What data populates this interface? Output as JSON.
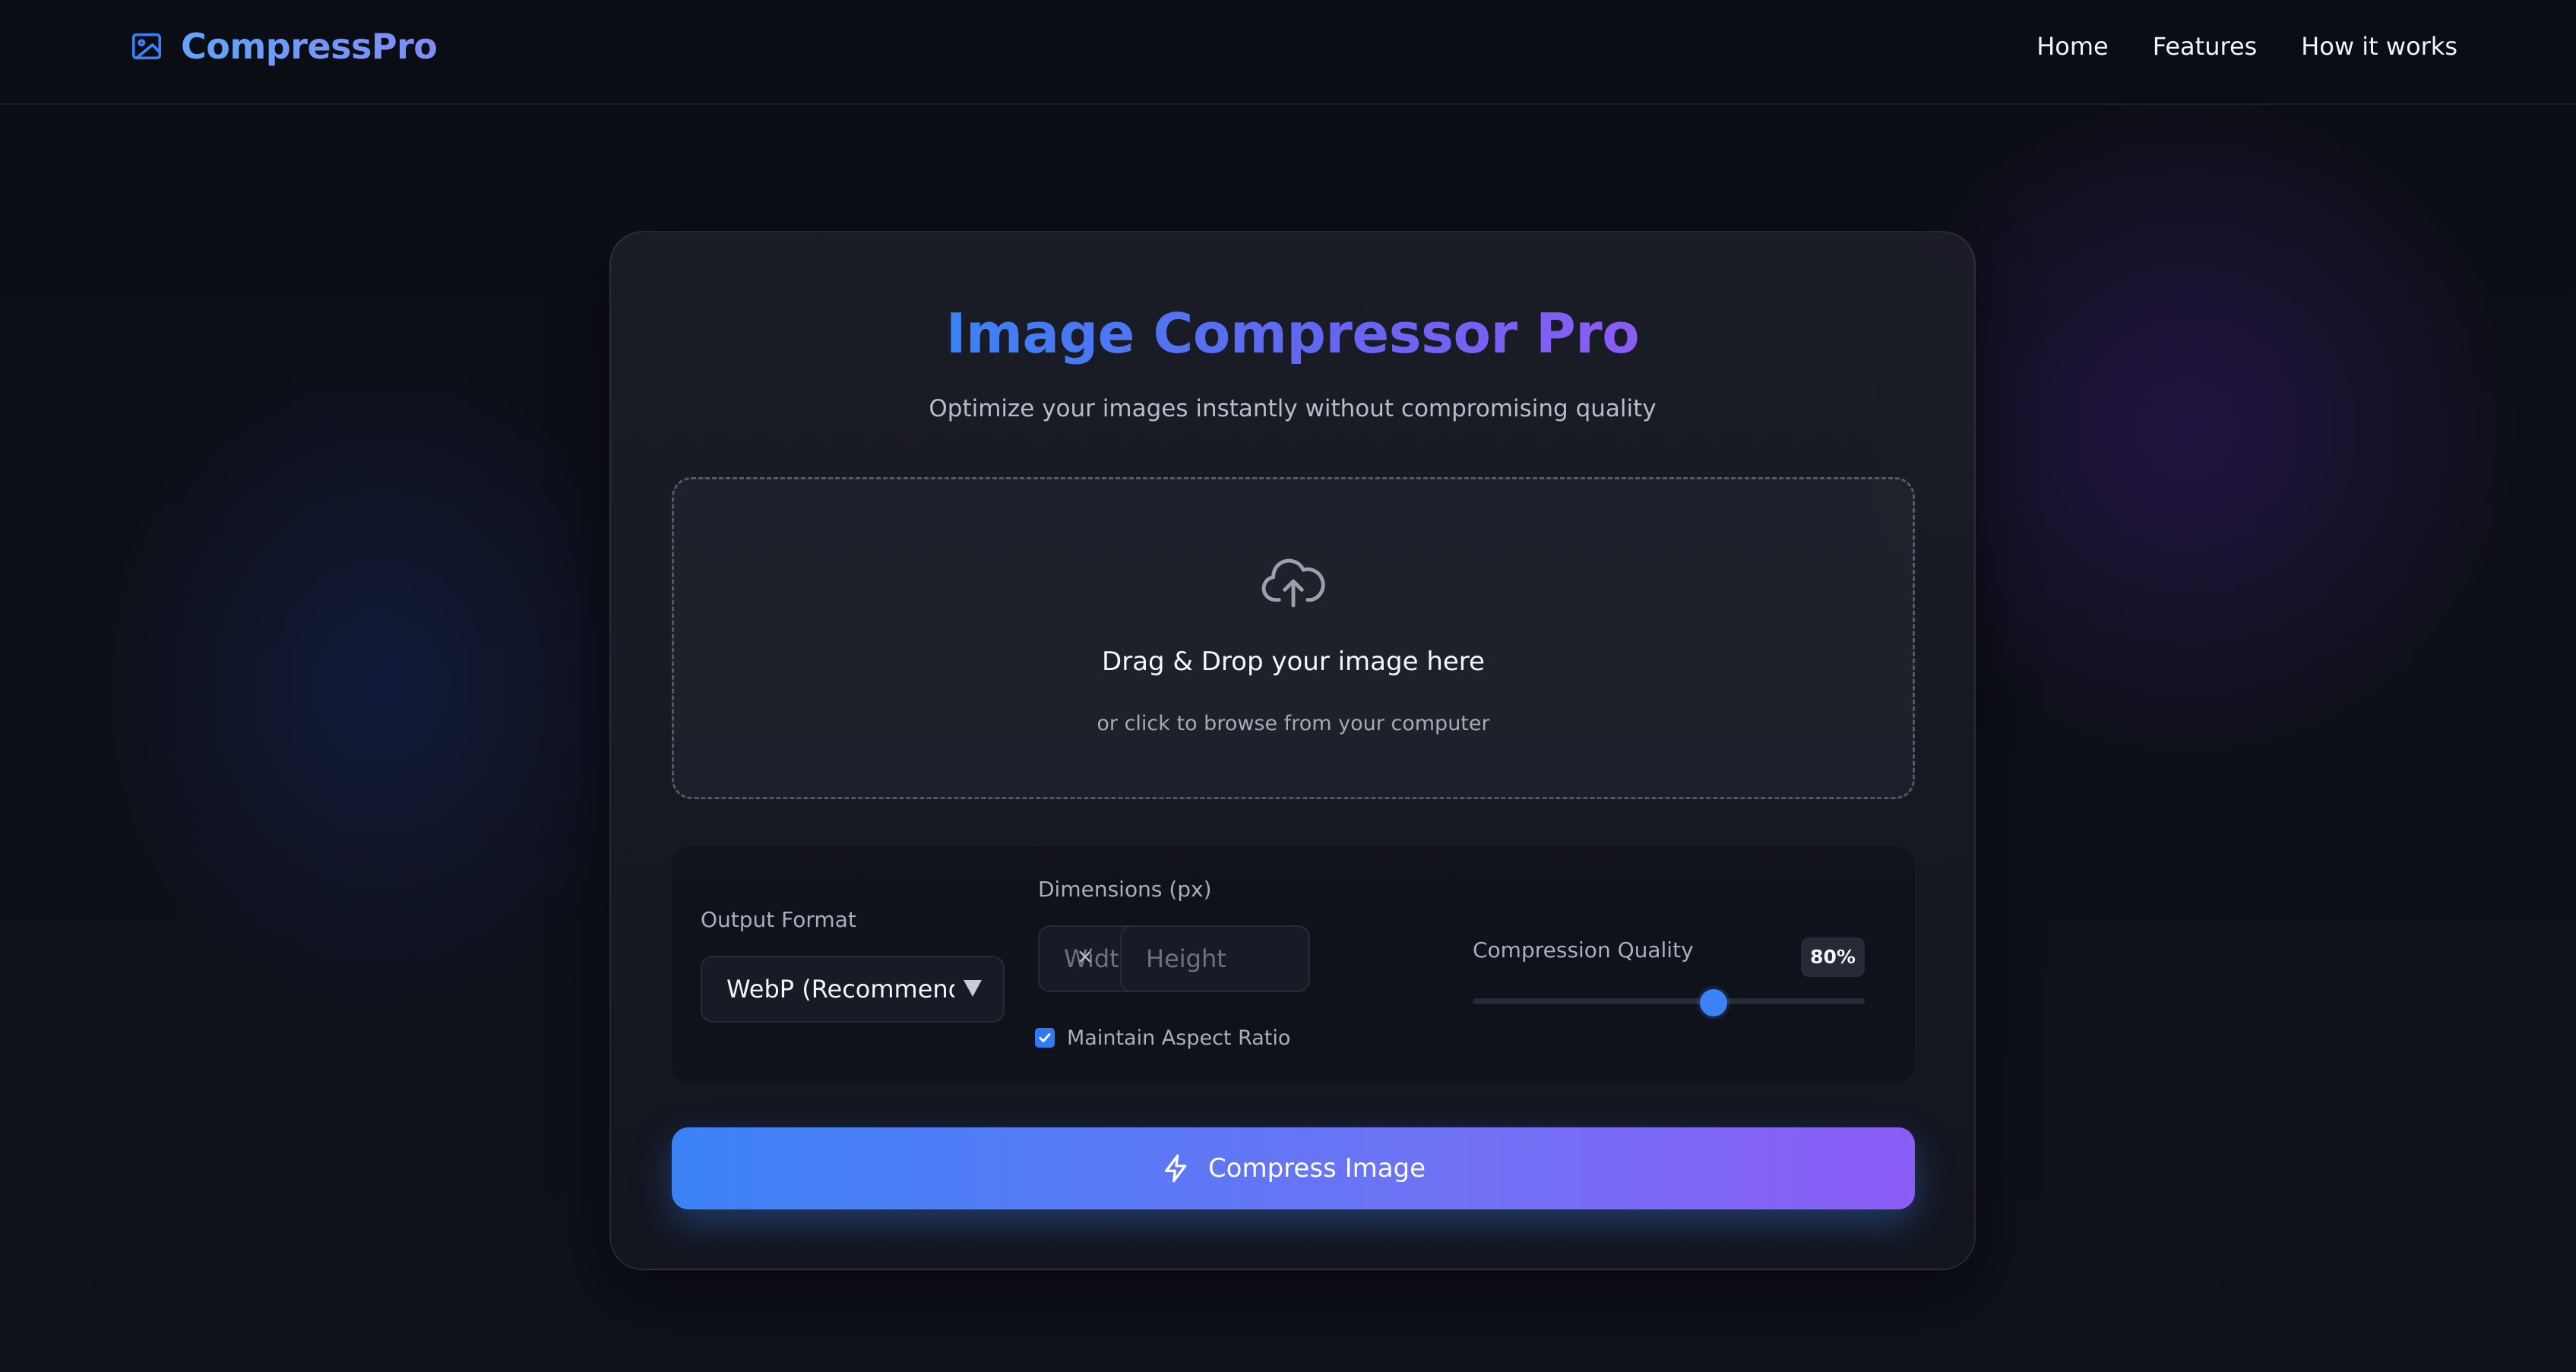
{
  "nav": {
    "brand": "CompressPro",
    "brand_icon": "image-icon",
    "links": [
      "Home",
      "Features",
      "How it works"
    ]
  },
  "card": {
    "title": "Image Compressor Pro",
    "subtitle": "Optimize your images instantly without compromising quality"
  },
  "dropzone": {
    "icon": "cloud-upload-icon",
    "title": "Drag & Drop your image here",
    "subtitle": "or click to browse from your computer"
  },
  "settings": {
    "output_format": {
      "label": "Output Format",
      "value": "WebP (Recommended)"
    },
    "dimensions": {
      "label": "Dimensions (px)",
      "width_placeholder": "Width",
      "height_placeholder": "Height",
      "separator": "×",
      "aspect_label": "Maintain Aspect Ratio",
      "aspect_checked": true
    },
    "quality": {
      "label": "Compression Quality",
      "value_text": "80%",
      "value_fraction": 0.8
    }
  },
  "action": {
    "icon": "lightning-icon",
    "label": "Compress Image"
  },
  "colors": {
    "accent_blue": "#3b82f6",
    "accent_purple": "#8b5cf6",
    "background": "#0d0f17",
    "card": "#1c1e28"
  }
}
